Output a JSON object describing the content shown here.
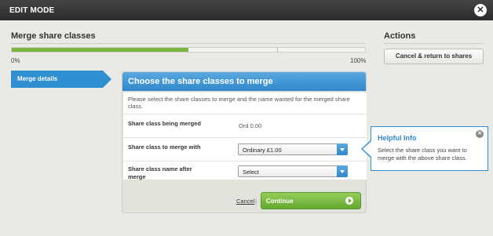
{
  "topbar": {
    "title": "EDIT MODE",
    "close_icon": "close-icon"
  },
  "main": {
    "heading": "Merge share classes",
    "progress": {
      "percent": 50,
      "label_start": "0%",
      "label_end": "100%",
      "fill_color": "#7cb442"
    }
  },
  "actions": {
    "heading": "Actions",
    "cancel_return_label": "Cancel & return to shares"
  },
  "steps": [
    {
      "label": "Merge details",
      "active": true
    }
  ],
  "panel": {
    "title": "Choose the share classes to merge",
    "intro": "Please select the share classes to merge and the name wanted for the merged share class.",
    "rows": [
      {
        "label": "Share class being merged",
        "value": "Ord 0.00"
      },
      {
        "label": "Share class to merge with",
        "selected": "Ordinary £1.00"
      },
      {
        "label": "Share class name after merge",
        "selected": "Select"
      }
    ],
    "cancel_label": "Cancel",
    "separator": "|",
    "continue_label": "Continue"
  },
  "helpful": {
    "title": "Helpful Info",
    "text": "Select the share class you want to merge with the above share class.",
    "close_glyph": "✕"
  },
  "colors": {
    "accent_blue": "#2f8fd1",
    "continue_green": "#63a830",
    "topbar": "#2b2b2b"
  }
}
